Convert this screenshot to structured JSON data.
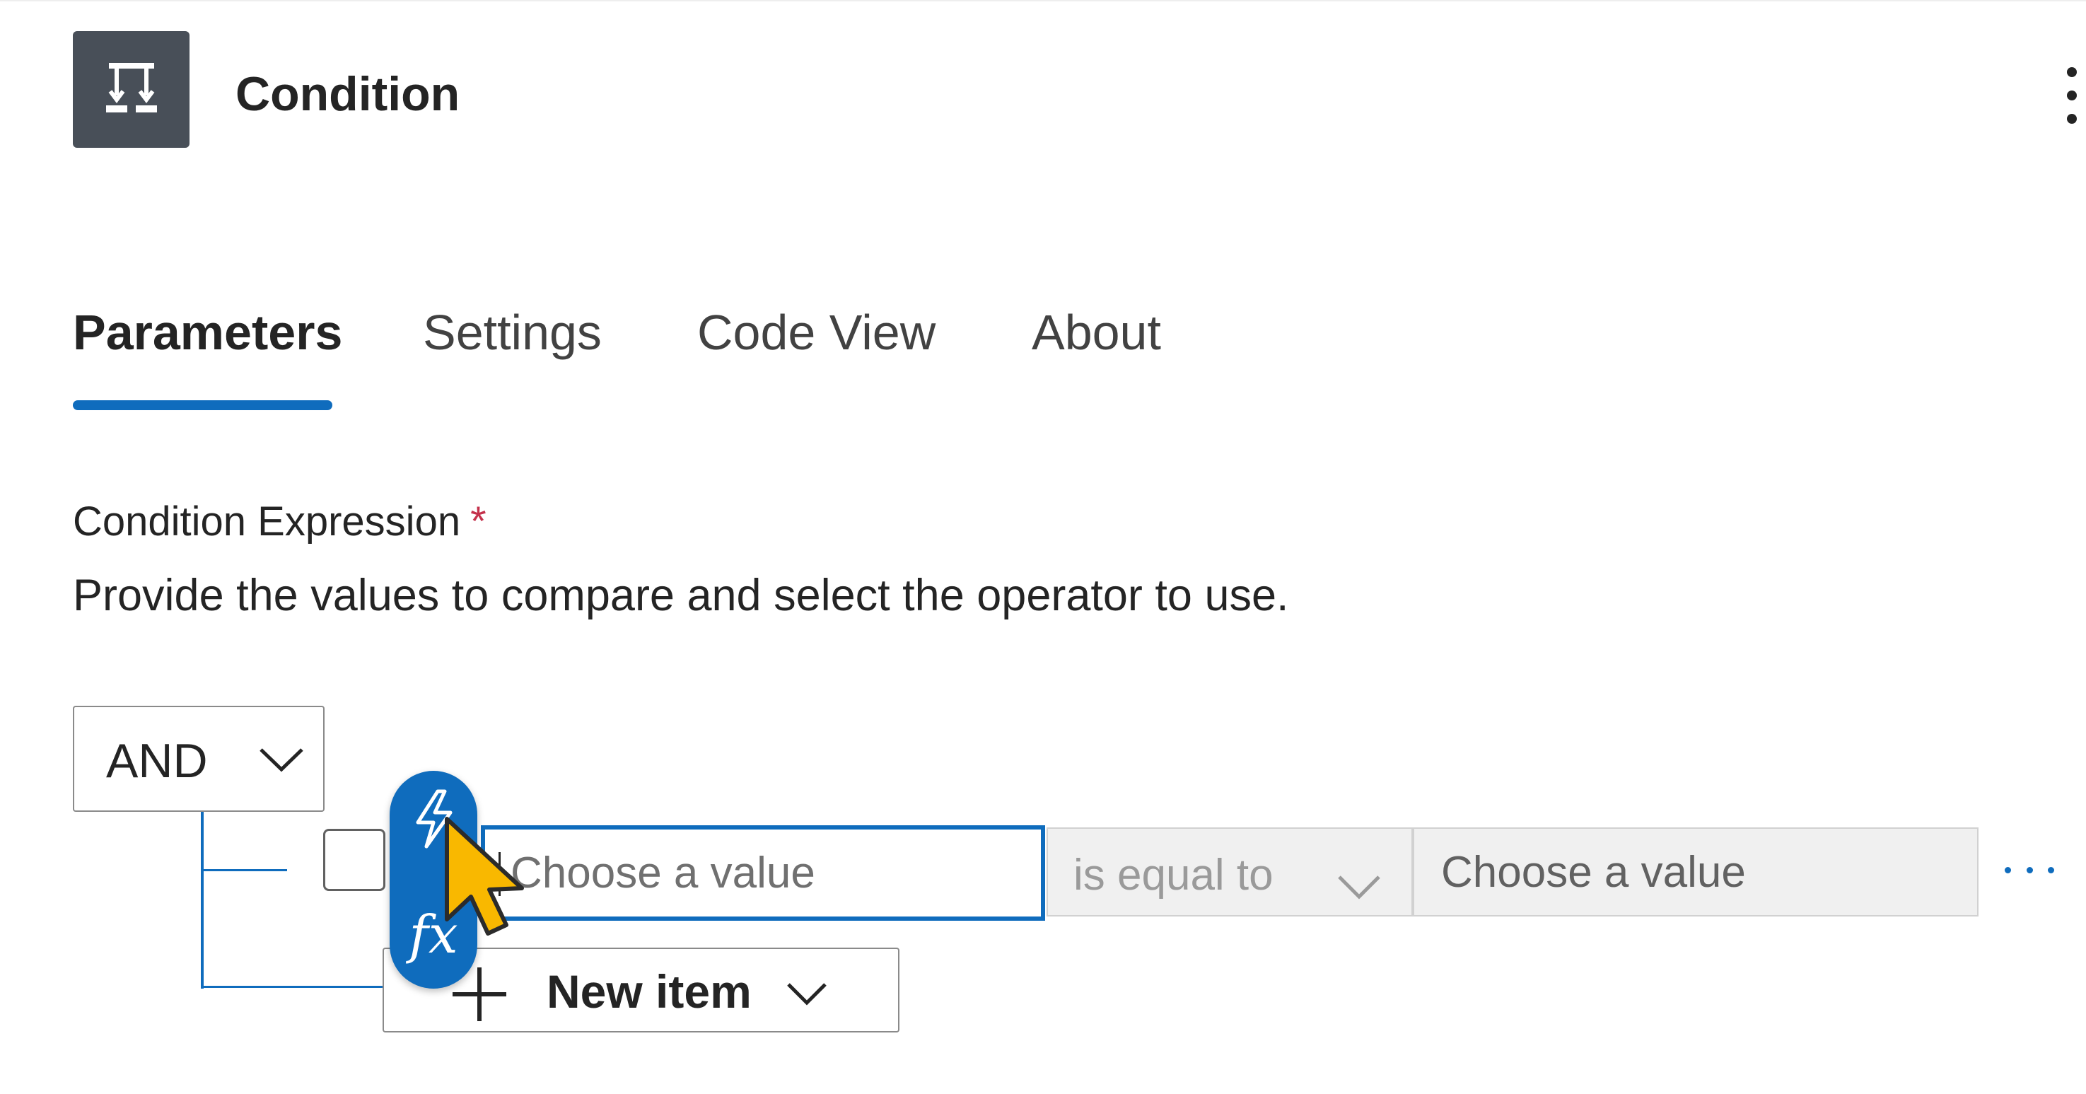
{
  "header": {
    "title": "Condition",
    "icon": "condition-icon",
    "more_icon": "more-vertical-icon"
  },
  "tabs": [
    {
      "label": "Parameters",
      "active": true
    },
    {
      "label": "Settings",
      "active": false
    },
    {
      "label": "Code View",
      "active": false
    },
    {
      "label": "About",
      "active": false
    }
  ],
  "condition": {
    "label": "Condition Expression",
    "required_mark": "*",
    "description": "Provide the values to compare and select the operator to use.",
    "group_operator": "AND",
    "row": {
      "left_placeholder": "Choose a value",
      "operator": "is equal to",
      "right_placeholder": "Choose a value"
    },
    "new_item_label": "New item"
  },
  "token_picker": {
    "dynamic_content_icon": "lightning-icon",
    "expression_label": "fx"
  },
  "colors": {
    "accent": "#0f6cbd",
    "icon_tile": "#484f58",
    "required": "#c4314b",
    "cursor": "#f9b800"
  }
}
